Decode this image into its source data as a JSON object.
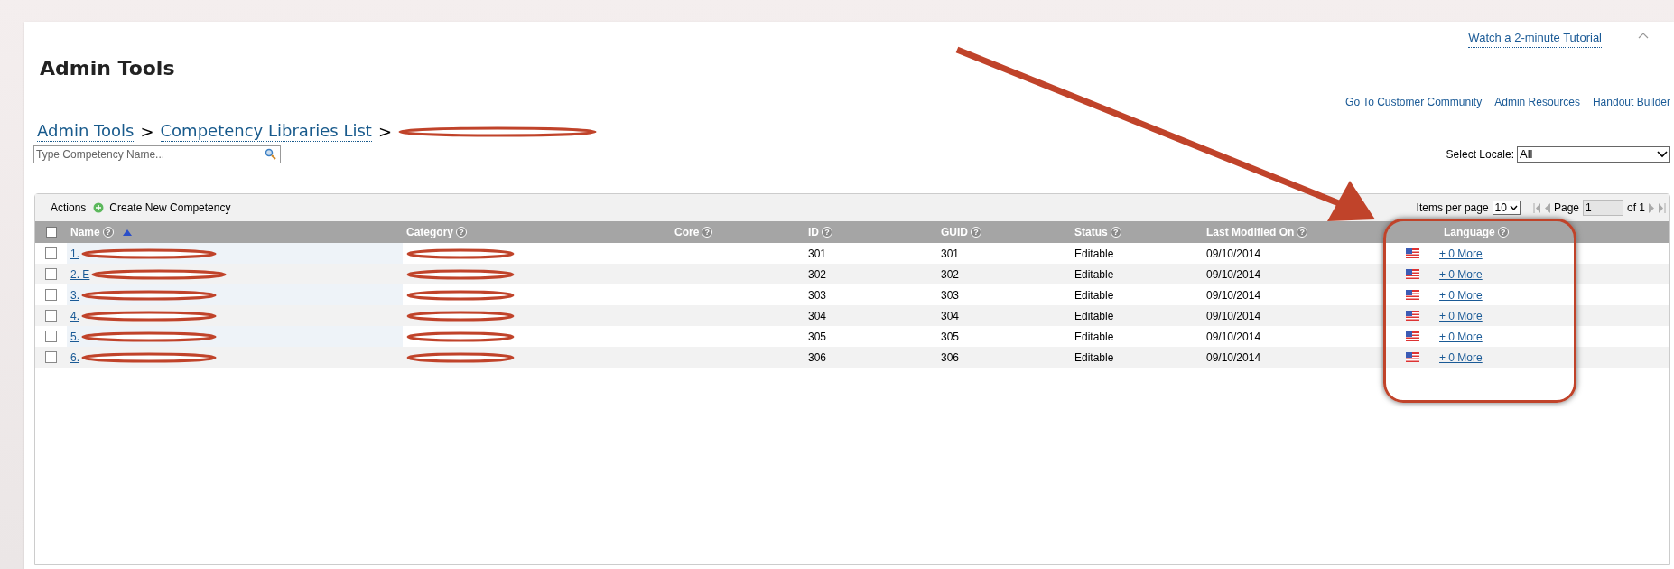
{
  "page_title": "Admin Tools",
  "tutorial_link": "Watch a 2-minute Tutorial",
  "top_links": [
    "Go To Customer Community",
    "Admin Resources",
    "Handout Builder"
  ],
  "breadcrumb": {
    "links": [
      "Admin Tools",
      "Competency Libraries List"
    ],
    "separators": [
      ">",
      ">"
    ]
  },
  "search": {
    "placeholder": "Type Competency Name..."
  },
  "locale": {
    "label": "Select Locale:",
    "value": "All"
  },
  "actions": {
    "label": "Actions",
    "create": "Create New Competency"
  },
  "pagination": {
    "items_label": "Items per page",
    "items_value": "10",
    "page_label": "Page",
    "page_value": "1",
    "of": "of 1"
  },
  "table": {
    "select_all_checked": false,
    "columns": [
      {
        "label": "Name",
        "help": "?",
        "sorted": true
      },
      {
        "label": "Category",
        "help": "?",
        "sorted": false
      },
      {
        "label": "Core",
        "help": "?",
        "sorted": false
      },
      {
        "label": "ID",
        "help": "?",
        "sorted": false
      },
      {
        "label": "GUID",
        "help": "?",
        "sorted": false
      },
      {
        "label": "Status",
        "help": "?",
        "sorted": false
      },
      {
        "label": "Last Modified On",
        "help": "?",
        "sorted": false
      },
      {
        "label": "Language",
        "help": "?",
        "sorted": false
      }
    ],
    "rows": [
      {
        "checked": false,
        "name": "1.",
        "id": "301",
        "guid": "301",
        "status": "Editable",
        "modified": "09/10/2014",
        "more": "+ 0 More"
      },
      {
        "checked": false,
        "name": "2. E",
        "id": "302",
        "guid": "302",
        "status": "Editable",
        "modified": "09/10/2014",
        "more": "+ 0 More"
      },
      {
        "checked": false,
        "name": "3.",
        "id": "303",
        "guid": "303",
        "status": "Editable",
        "modified": "09/10/2014",
        "more": "+ 0 More"
      },
      {
        "checked": false,
        "name": "4.",
        "id": "304",
        "guid": "304",
        "status": "Editable",
        "modified": "09/10/2014",
        "more": "+ 0 More"
      },
      {
        "checked": false,
        "name": "5.",
        "id": "305",
        "guid": "305",
        "status": "Editable",
        "modified": "09/10/2014",
        "more": "+ 0 More"
      },
      {
        "checked": false,
        "name": "6.",
        "id": "306",
        "guid": "306",
        "status": "Editable",
        "modified": "09/10/2014",
        "more": "+ 0 More"
      }
    ]
  }
}
